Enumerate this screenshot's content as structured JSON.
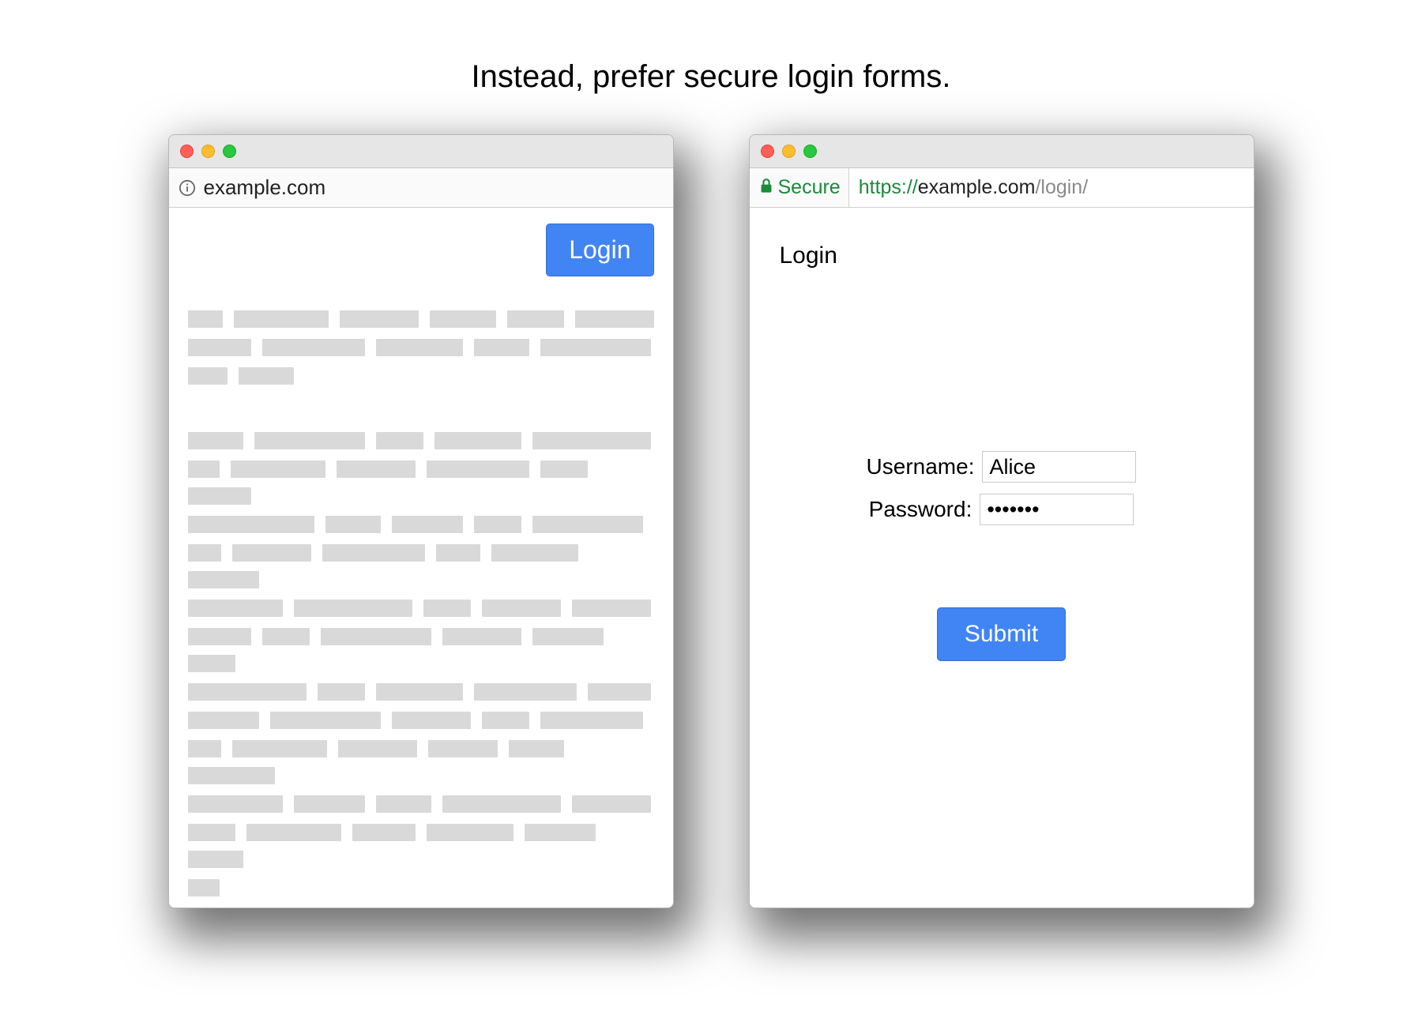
{
  "caption": "Instead, prefer secure login forms.",
  "left": {
    "address": "example.com",
    "login_button": "Login"
  },
  "right": {
    "secure_label": "Secure",
    "url_scheme": "https://",
    "url_host": "example.com",
    "url_path": "/login/",
    "heading": "Login",
    "username_label": "Username:",
    "username_value": "Alice",
    "password_label": "Password:",
    "password_value": "•••••••",
    "submit_label": "Submit"
  }
}
